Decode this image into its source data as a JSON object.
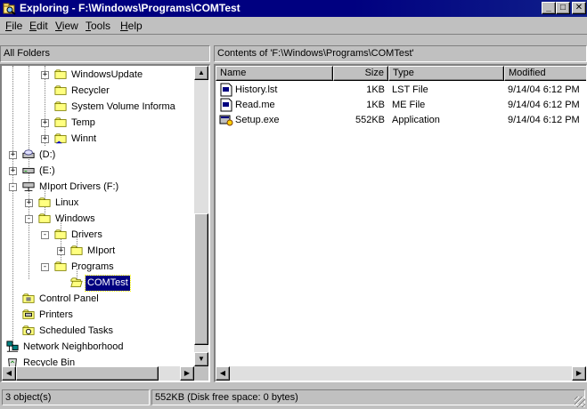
{
  "window": {
    "title": "Exploring - F:\\Windows\\Programs\\COMTest",
    "minimize": "_",
    "maximize": "□",
    "close": "✕"
  },
  "menu": [
    {
      "label": "File",
      "accel": "F"
    },
    {
      "label": "Edit",
      "accel": "E"
    },
    {
      "label": "View",
      "accel": "V"
    },
    {
      "label": "Tools",
      "accel": "T"
    },
    {
      "label": "Help",
      "accel": "H"
    }
  ],
  "left_header": "All Folders",
  "right_header": "Contents of 'F:\\Windows\\Programs\\COMTest'",
  "tree": [
    {
      "label": "WindowsUpdate",
      "icon": "folder-icon",
      "expander": "+"
    },
    {
      "label": "Recycler",
      "icon": "folder-icon",
      "expander": ""
    },
    {
      "label": "System Volume Informa",
      "icon": "folder-icon",
      "expander": ""
    },
    {
      "label": "Temp",
      "icon": "folder-icon",
      "expander": "+"
    },
    {
      "label": "Winnt",
      "icon": "shared-folder-icon",
      "expander": "+"
    },
    {
      "label": "(D:)",
      "icon": "cd-drive-icon",
      "expander": "+"
    },
    {
      "label": "(E:)",
      "icon": "drive-icon",
      "expander": "+"
    },
    {
      "label": "MIport Drivers (F:)",
      "icon": "network-drive-icon",
      "expander": "-"
    },
    {
      "label": "Linux",
      "icon": "folder-icon",
      "expander": "+"
    },
    {
      "label": "Windows",
      "icon": "folder-icon",
      "expander": "-"
    },
    {
      "label": "Drivers",
      "icon": "folder-icon",
      "expander": "-"
    },
    {
      "label": "MIport",
      "icon": "folder-icon",
      "expander": "+"
    },
    {
      "label": "Programs",
      "icon": "folder-icon",
      "expander": "-"
    },
    {
      "label": "COMTest",
      "icon": "open-folder-icon",
      "expander": ""
    },
    {
      "label": "Control Panel",
      "icon": "control-panel-icon",
      "expander": ""
    },
    {
      "label": "Printers",
      "icon": "printers-icon",
      "expander": ""
    },
    {
      "label": "Scheduled Tasks",
      "icon": "scheduled-tasks-icon",
      "expander": ""
    },
    {
      "label": "Network Neighborhood",
      "icon": "network-icon",
      "expander": "+"
    },
    {
      "label": "Recycle Bin",
      "icon": "recycle-bin-icon",
      "expander": ""
    }
  ],
  "columns": {
    "name": "Name",
    "size": "Size",
    "type": "Type",
    "modified": "Modified"
  },
  "files": [
    {
      "name": "History.lst",
      "size": "1KB",
      "type": "LST File",
      "modified": "9/14/04 6:12 PM",
      "icon": "document-icon"
    },
    {
      "name": "Read.me",
      "size": "1KB",
      "type": "ME File",
      "modified": "9/14/04 6:12 PM",
      "icon": "document-icon"
    },
    {
      "name": "Setup.exe",
      "size": "552KB",
      "type": "Application",
      "modified": "9/14/04 6:12 PM",
      "icon": "setup-app-icon"
    }
  ],
  "status": {
    "objects": "3 object(s)",
    "size": "552KB (Disk free space: 0 bytes)"
  },
  "colors": {
    "titlebar": "#000080",
    "selection": "#000080",
    "folder": "#ffff80"
  }
}
